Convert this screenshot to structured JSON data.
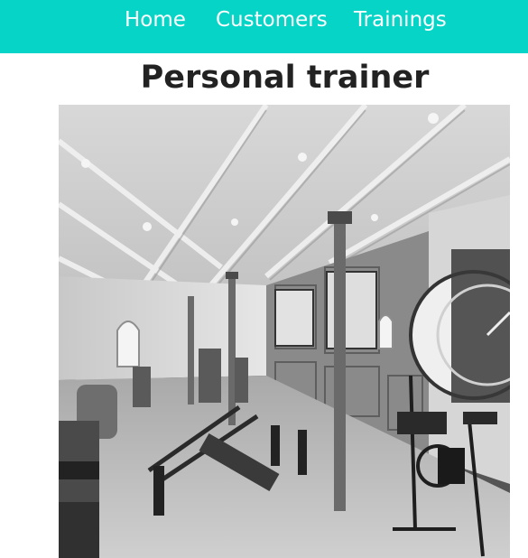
{
  "nav": {
    "items": [
      {
        "label": "Home"
      },
      {
        "label": "Customers"
      },
      {
        "label": "Trainings"
      }
    ],
    "background": "#06d4c6",
    "text_color": "#ffffff"
  },
  "page": {
    "title": "Personal trainer"
  },
  "image": {
    "description_icon": "gym-photo",
    "style": "black-and-white"
  }
}
